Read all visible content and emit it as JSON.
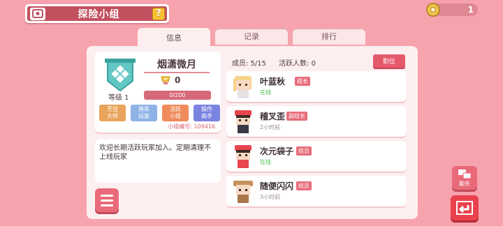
{
  "header": {
    "title": "探险小组",
    "help_label": "?",
    "title_icon": "group-icon"
  },
  "currency": {
    "value": "1",
    "icon": "coin-icon"
  },
  "tabs": [
    {
      "label": "信息",
      "active": true
    },
    {
      "label": "记录",
      "active": false
    },
    {
      "label": "排行",
      "active": false
    }
  ],
  "group": {
    "name": "烟潇微月",
    "points": "0",
    "level_label": "等级 1",
    "level_progress_text": "0/200",
    "level_progress": 0,
    "id_label": "小组编号: 109416",
    "tags": [
      {
        "label": "烹饪\n大师",
        "color": "#e9a35a"
      },
      {
        "label": "佛系\n玩家",
        "color": "#8fb3e6"
      },
      {
        "label": "活跃\n小组",
        "color": "#ef8b5c"
      },
      {
        "label": "操作\n高手",
        "color": "#7b83e0"
      }
    ]
  },
  "announcement": "欢迎长期活跃玩家加入。定期清理不上线玩家",
  "members_header": {
    "members": "成员: 5/15",
    "active": "活跃人数: 0",
    "role_button": "职位"
  },
  "members": [
    {
      "name": "叶蓝秋",
      "role": "组长",
      "status": "在线",
      "online": true
    },
    {
      "name": "稽叉歪",
      "role": "副组长",
      "status": "2小时前",
      "online": false
    },
    {
      "name": "次元袋子",
      "role": "组员",
      "status": "在线",
      "online": true
    },
    {
      "name": "随便闪闪",
      "role": "组员",
      "status": "3小时前",
      "online": false
    }
  ],
  "chat_button": "聊天",
  "colors": {
    "background": "#f7a3ad",
    "accent": "#e86a79",
    "title_bar": "#c2505f",
    "online": "#52c158"
  }
}
